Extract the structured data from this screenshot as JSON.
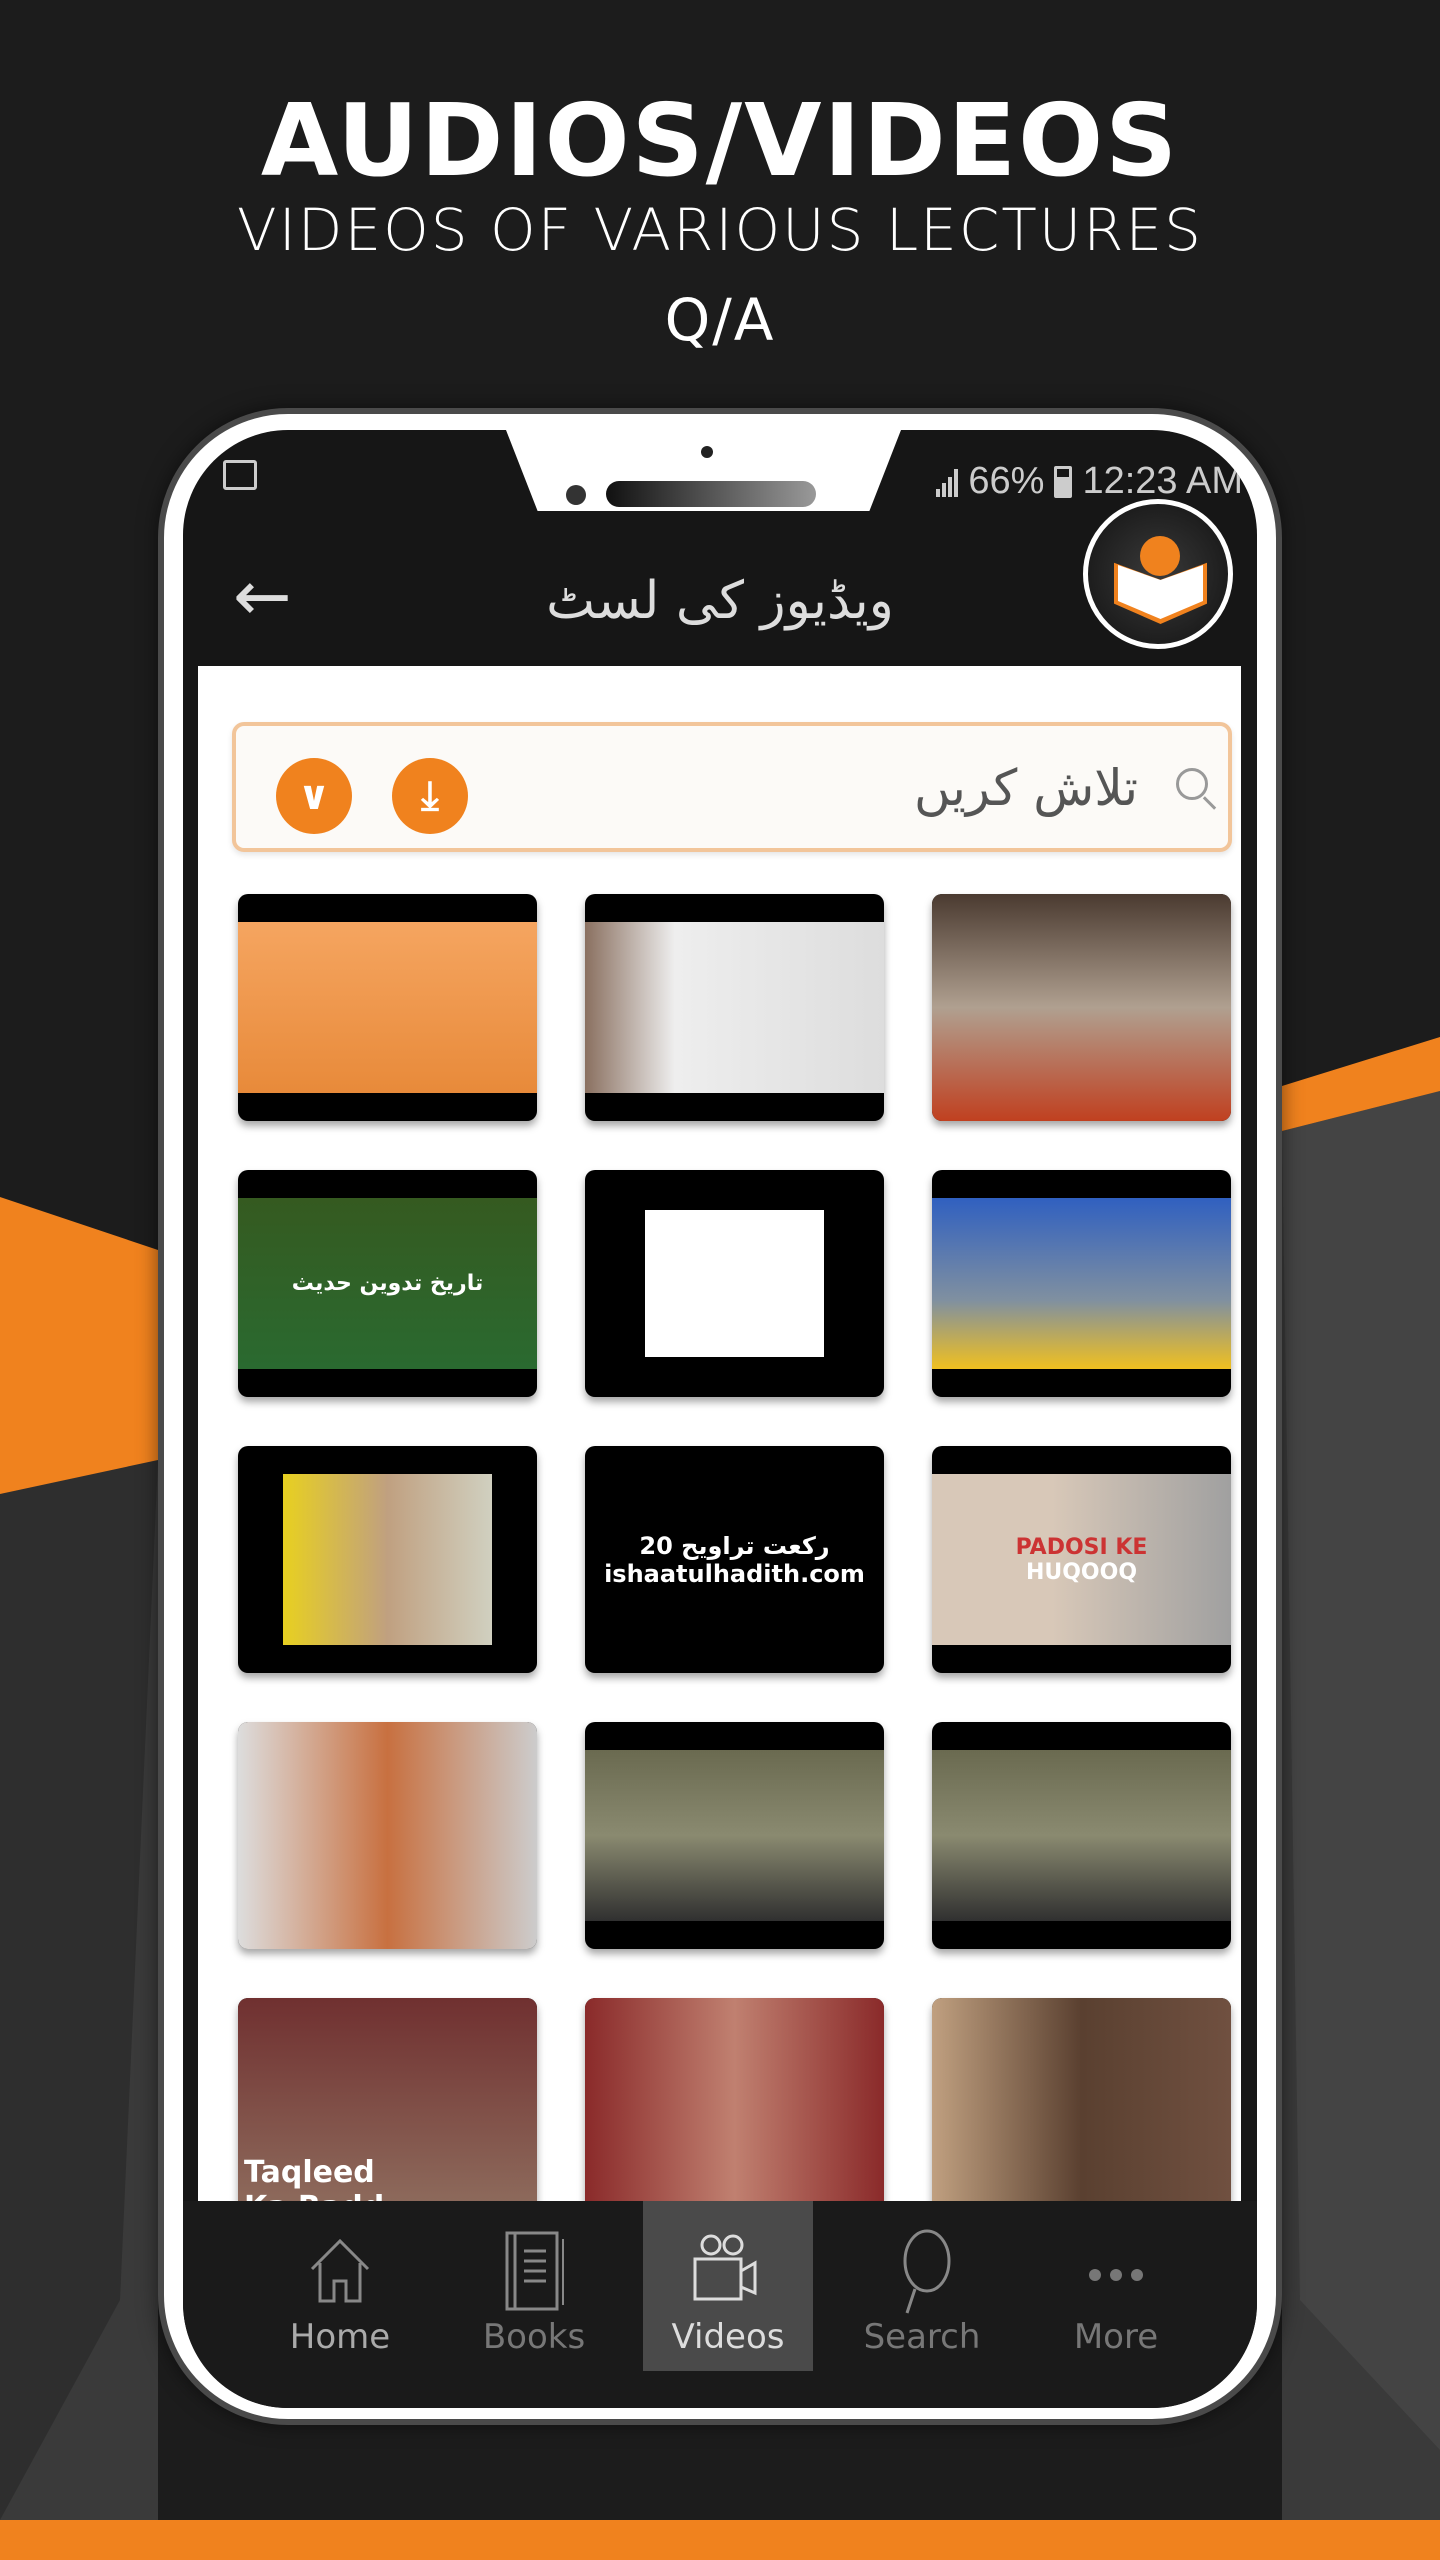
{
  "promo": {
    "title": "AUDIOS/VIDEOS",
    "subtitle": "VIDEOS OF VARIOUS LECTURES",
    "line2": "Q/A"
  },
  "colors": {
    "accent": "#f0821e",
    "background": "#1c1c1c",
    "appbar": "#161616",
    "search_border": "#f2c59a"
  },
  "status_bar": {
    "battery": "66%",
    "time": "12:23 AM"
  },
  "appbar": {
    "title": "ویڈیوز کی لسٹ",
    "back_icon": "arrow-left-icon",
    "logo": "sun-book-logo"
  },
  "search": {
    "placeholder": "تلاش کریں",
    "value": "",
    "dropdown_icon": "chevron-down-icon",
    "download_icon": "download-icon"
  },
  "thumbnails": [
    {
      "caption": ""
    },
    {
      "caption": ""
    },
    {
      "caption": ""
    },
    {
      "caption": "تاریخ تدوین حدیث"
    },
    {
      "caption": ""
    },
    {
      "caption": ""
    },
    {
      "caption": ""
    },
    {
      "caption": "20 رکعت تراویح",
      "caption2": "ishaatulhadith.com"
    },
    {
      "caption": "PADOSI KE",
      "caption2": "HUQOOQ"
    },
    {
      "caption": ""
    },
    {
      "caption": ""
    },
    {
      "caption": ""
    },
    {
      "caption": "Taqleed",
      "caption2": "Ka Radd"
    },
    {
      "caption": ""
    },
    {
      "caption": ""
    }
  ],
  "nav": [
    {
      "label": "Home",
      "icon": "home-icon"
    },
    {
      "label": "Books",
      "icon": "book-icon"
    },
    {
      "label": "Videos",
      "icon": "video-camera-icon",
      "active": true
    },
    {
      "label": "Search",
      "icon": "search-icon"
    },
    {
      "label": "More",
      "icon": "more-dots-icon"
    }
  ]
}
